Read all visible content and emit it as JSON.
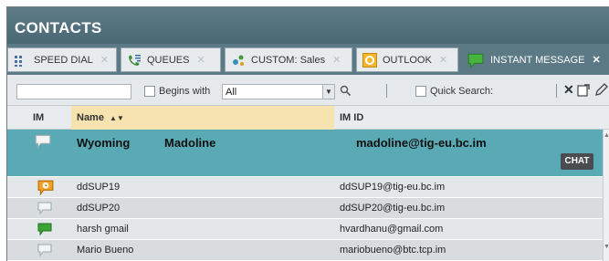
{
  "window": {
    "title": "CONTACTS"
  },
  "tabs": [
    {
      "label": "SPEED DIAL",
      "icon": "grid-icon"
    },
    {
      "label": "QUEUES",
      "icon": "queue-icon"
    },
    {
      "label": "CUSTOM: Sales",
      "icon": "custom-icon"
    },
    {
      "label": "OUTLOOK",
      "icon": "outlook-icon"
    },
    {
      "label": "INSTANT MESSAGE",
      "icon": "instant-message-icon"
    }
  ],
  "toolbar": {
    "search_value": "",
    "begins_with_label": "Begins with",
    "filter_select_value": "All",
    "quick_search_label": "Quick Search:"
  },
  "columns": {
    "im": "IM",
    "name": "Name",
    "im_id": "IM ID"
  },
  "selected_contact": {
    "first_name": "Wyoming",
    "last_name": "Madoline",
    "im_id": "madoline@tig-eu.bc.im",
    "chat_label": "CHAT"
  },
  "contacts": [
    {
      "name": "ddSUP19",
      "im_id": "ddSUP19@tig-eu.bc.im",
      "status_icon": "away-chat-icon"
    },
    {
      "name": "ddSUP20",
      "im_id": "ddSUP20@tig-eu.bc.im",
      "status_icon": "offline-chat-icon"
    },
    {
      "name": "harsh gmail",
      "im_id": "hvardhanu@gmail.com",
      "status_icon": "online-chat-icon"
    },
    {
      "name": "Mario Bueno",
      "im_id": "mariobueno@btc.tcp.im",
      "status_icon": "offline-chat-icon"
    }
  ],
  "colors": {
    "header_bar": "#4f6d79",
    "selected_row": "#5aaab6",
    "sorted_column": "#f7e3b0",
    "online": "#3aa435",
    "away": "#f0a020"
  }
}
